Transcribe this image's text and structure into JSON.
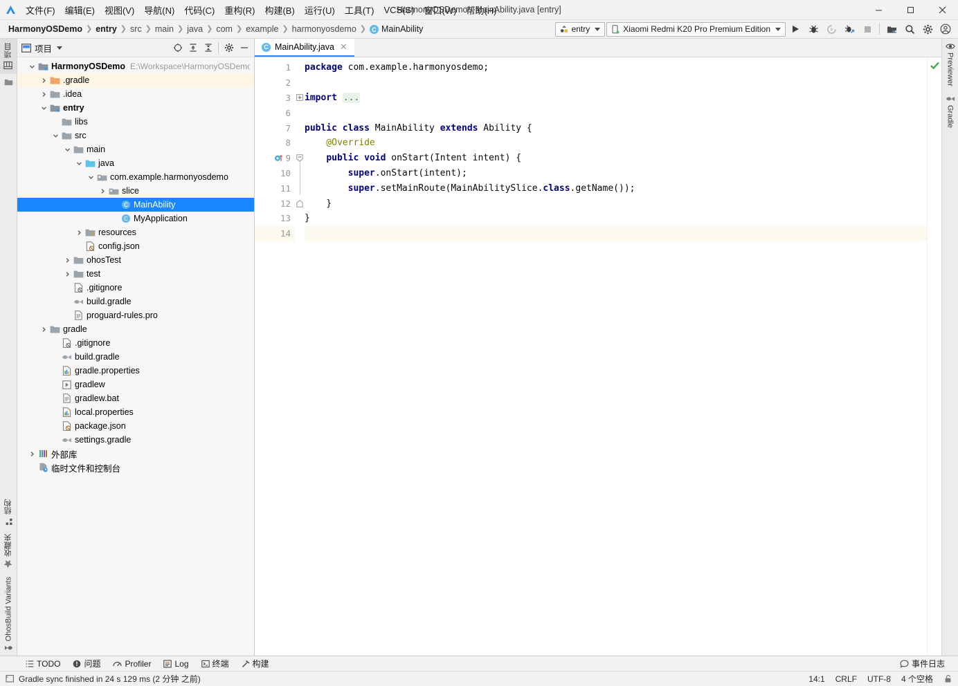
{
  "window": {
    "title": "HarmonyOSDemo - MainAbility.java [entry]",
    "minimize_label": "–",
    "maximize_label": "□",
    "close_label": "✕"
  },
  "menubar": {
    "items": [
      {
        "label": "文件(F)"
      },
      {
        "label": "编辑(E)"
      },
      {
        "label": "视图(V)"
      },
      {
        "label": "导航(N)"
      },
      {
        "label": "代码(C)"
      },
      {
        "label": "重构(R)"
      },
      {
        "label": "构建(B)"
      },
      {
        "label": "运行(U)"
      },
      {
        "label": "工具(T)"
      },
      {
        "label": "VCS(S)"
      },
      {
        "label": "窗口(W)"
      },
      {
        "label": "帮助(H)"
      }
    ]
  },
  "navbar": {
    "breadcrumbs": [
      {
        "label": "HarmonyOSDemo",
        "style": "bold"
      },
      {
        "label": "entry",
        "style": "bold"
      },
      {
        "label": "src",
        "style": "dim"
      },
      {
        "label": "main",
        "style": "dim"
      },
      {
        "label": "java",
        "style": "dim"
      },
      {
        "label": "com",
        "style": "dim"
      },
      {
        "label": "example",
        "style": "dim"
      },
      {
        "label": "harmonyosdemo",
        "style": "dim"
      },
      {
        "label": "MainAbility",
        "style": "normal",
        "icon": "class-icon",
        "badge": "C"
      }
    ],
    "separator": "❯",
    "run_config": {
      "label": "entry",
      "icon": "module-icon"
    },
    "device": {
      "label": "Xiaomi Redmi K20 Pro Premium Edition",
      "icon": "phone-icon"
    },
    "actions": [
      {
        "name": "run-button",
        "glyph": "▶"
      },
      {
        "name": "debug-button",
        "glyph": "bug"
      },
      {
        "name": "run-coverage-button",
        "glyph": "coverage"
      },
      {
        "name": "attach-debugger-button",
        "glyph": "attach"
      },
      {
        "name": "stop-button",
        "glyph": "■"
      },
      {
        "name": "project-structure-button",
        "glyph": "structure"
      },
      {
        "name": "search-everywhere-button",
        "glyph": "search"
      },
      {
        "name": "settings-button",
        "glyph": "gear"
      },
      {
        "name": "account-button",
        "glyph": "account"
      }
    ]
  },
  "left_strip": {
    "top_tabs": [
      {
        "label": "项目",
        "name": "tool-tab-project",
        "active": true
      },
      {
        "label": "",
        "name": "tool-tab-resource-manager",
        "active": false
      }
    ],
    "bottom_tabs": [
      {
        "label": "结构",
        "name": "tool-tab-structure"
      },
      {
        "label": "收藏夹",
        "name": "tool-tab-favorites"
      },
      {
        "label": "OhosBuild Variants",
        "name": "tool-tab-ohosbuild-variants"
      }
    ]
  },
  "right_strip": {
    "tabs": [
      {
        "label": "Previewer",
        "name": "tool-tab-previewer"
      },
      {
        "label": "Gradle",
        "name": "tool-tab-gradle"
      }
    ]
  },
  "project_panel": {
    "title": "项目",
    "header_icons": [
      {
        "name": "select-opened-file-icon",
        "glyph": "target"
      },
      {
        "name": "expand-all-icon",
        "glyph": "expand"
      },
      {
        "name": "collapse-all-icon",
        "glyph": "collapse"
      },
      {
        "name": "panel-settings-icon",
        "glyph": "gear"
      },
      {
        "name": "hide-panel-icon",
        "glyph": "minus"
      }
    ],
    "tree": [
      {
        "label": "HarmonyOSDemo",
        "path": "E:\\Workspace\\HarmonyOSDemo",
        "indent": 0,
        "arrow": "down",
        "icon": "module-folder-icon",
        "bold": true
      },
      {
        "label": ".gradle",
        "indent": 1,
        "arrow": "right",
        "icon": "folder-orange-icon",
        "highlight": true
      },
      {
        "label": ".idea",
        "indent": 1,
        "arrow": "right",
        "icon": "folder-icon"
      },
      {
        "label": "entry",
        "indent": 1,
        "arrow": "down",
        "icon": "module-folder-icon",
        "bold": true
      },
      {
        "label": "libs",
        "indent": 2,
        "arrow": "none",
        "icon": "folder-icon"
      },
      {
        "label": "src",
        "indent": 2,
        "arrow": "down",
        "icon": "folder-icon"
      },
      {
        "label": "main",
        "indent": 3,
        "arrow": "down",
        "icon": "folder-icon"
      },
      {
        "label": "java",
        "indent": 4,
        "arrow": "down",
        "icon": "folder-source-icon"
      },
      {
        "label": "com.example.harmonyosdemo",
        "indent": 5,
        "arrow": "down",
        "icon": "package-icon"
      },
      {
        "label": "slice",
        "indent": 6,
        "arrow": "right",
        "icon": "package-icon"
      },
      {
        "label": "MainAbility",
        "indent": 7,
        "arrow": "none",
        "icon": "java-class-icon",
        "selected": true
      },
      {
        "label": "MyApplication",
        "indent": 7,
        "arrow": "none",
        "icon": "java-class-icon"
      },
      {
        "label": "resources",
        "indent": 4,
        "arrow": "right",
        "icon": "folder-resource-icon"
      },
      {
        "label": "config.json",
        "indent": 4,
        "arrow": "none",
        "icon": "json-file-icon"
      },
      {
        "label": "ohosTest",
        "indent": 3,
        "arrow": "right",
        "icon": "folder-icon"
      },
      {
        "label": "test",
        "indent": 3,
        "arrow": "right",
        "icon": "folder-icon"
      },
      {
        "label": ".gitignore",
        "indent": 3,
        "arrow": "none",
        "icon": "gitignore-file-icon"
      },
      {
        "label": "build.gradle",
        "indent": 3,
        "arrow": "none",
        "icon": "gradle-file-icon"
      },
      {
        "label": "proguard-rules.pro",
        "indent": 3,
        "arrow": "none",
        "icon": "text-file-icon"
      },
      {
        "label": "gradle",
        "indent": 1,
        "arrow": "right",
        "icon": "folder-icon"
      },
      {
        "label": ".gitignore",
        "indent": 2,
        "arrow": "none",
        "icon": "gitignore-file-icon"
      },
      {
        "label": "build.gradle",
        "indent": 2,
        "arrow": "none",
        "icon": "gradle-file-icon"
      },
      {
        "label": "gradle.properties",
        "indent": 2,
        "arrow": "none",
        "icon": "properties-file-icon"
      },
      {
        "label": "gradlew",
        "indent": 2,
        "arrow": "none",
        "icon": "script-file-icon"
      },
      {
        "label": "gradlew.bat",
        "indent": 2,
        "arrow": "none",
        "icon": "text-file-icon"
      },
      {
        "label": "local.properties",
        "indent": 2,
        "arrow": "none",
        "icon": "properties-file-icon"
      },
      {
        "label": "package.json",
        "indent": 2,
        "arrow": "none",
        "icon": "json-file-icon"
      },
      {
        "label": "settings.gradle",
        "indent": 2,
        "arrow": "none",
        "icon": "gradle-file-icon"
      },
      {
        "label": "外部库",
        "indent": 0,
        "arrow": "right",
        "icon": "external-libraries-icon"
      },
      {
        "label": "临时文件和控制台",
        "indent": 0,
        "arrow": "none",
        "icon": "scratches-icon"
      }
    ]
  },
  "editor": {
    "tabs": [
      {
        "label": "MainAbility.java",
        "badge": "C",
        "close": "✕",
        "active": true
      }
    ],
    "inspection_status": "ok-check",
    "lines": [
      {
        "num": "1",
        "tokens": [
          {
            "t": "package",
            "c": "kw"
          },
          {
            "t": " com.example.harmonyosdemo;",
            "c": "plain"
          }
        ]
      },
      {
        "num": "2",
        "tokens": []
      },
      {
        "num": "3",
        "fold": "plus",
        "tokens": [
          {
            "t": "import",
            "c": "kw"
          },
          {
            "t": " ",
            "c": "plain"
          },
          {
            "t": "...",
            "c": "fold"
          }
        ]
      },
      {
        "num": "6",
        "tokens": []
      },
      {
        "num": "7",
        "tokens": [
          {
            "t": "public",
            "c": "kw"
          },
          {
            "t": " ",
            "c": "plain"
          },
          {
            "t": "class",
            "c": "kw"
          },
          {
            "t": " MainAbility ",
            "c": "plain"
          },
          {
            "t": "extends",
            "c": "kw"
          },
          {
            "t": " Ability {",
            "c": "plain"
          }
        ]
      },
      {
        "num": "8",
        "tokens": [
          {
            "t": "    @Override",
            "c": "ann"
          }
        ]
      },
      {
        "num": "9",
        "marker": "override-method-icon",
        "fold": "minus",
        "tokens": [
          {
            "t": "    ",
            "c": "plain"
          },
          {
            "t": "public",
            "c": "kw"
          },
          {
            "t": " ",
            "c": "plain"
          },
          {
            "t": "void",
            "c": "kw"
          },
          {
            "t": " onStart(Intent intent) {",
            "c": "plain"
          }
        ]
      },
      {
        "num": "10",
        "tokens": [
          {
            "t": "        ",
            "c": "plain"
          },
          {
            "t": "super",
            "c": "kw"
          },
          {
            "t": ".onStart(intent);",
            "c": "plain"
          }
        ]
      },
      {
        "num": "11",
        "tokens": [
          {
            "t": "        ",
            "c": "plain"
          },
          {
            "t": "super",
            "c": "kw"
          },
          {
            "t": ".setMainRoute(MainAbilitySlice.",
            "c": "plain"
          },
          {
            "t": "class",
            "c": "kw"
          },
          {
            "t": ".getName());",
            "c": "plain"
          }
        ]
      },
      {
        "num": "12",
        "fold": "end",
        "tokens": [
          {
            "t": "    }",
            "c": "plain"
          }
        ]
      },
      {
        "num": "13",
        "tokens": [
          {
            "t": "}",
            "c": "plain"
          }
        ]
      },
      {
        "num": "14",
        "current": true,
        "tokens": []
      }
    ]
  },
  "bottom_bar": {
    "tabs": [
      {
        "label": "TODO",
        "name": "bottom-tab-todo",
        "icon": "todo-icon"
      },
      {
        "label": "问题",
        "name": "bottom-tab-problems",
        "icon": "problems-icon"
      },
      {
        "label": "Profiler",
        "name": "bottom-tab-profiler",
        "icon": "profiler-icon"
      },
      {
        "label": "Log",
        "name": "bottom-tab-log",
        "icon": "log-icon"
      },
      {
        "label": "终端",
        "name": "bottom-tab-terminal",
        "icon": "terminal-icon"
      },
      {
        "label": "构建",
        "name": "bottom-tab-build",
        "icon": "build-icon"
      }
    ],
    "event_log": {
      "label": "事件日志",
      "icon": "event-log-icon"
    }
  },
  "statusbar": {
    "message": "Gradle sync finished in 24 s 129 ms (2 分钟 之前)",
    "message_icon": "status-message-icon",
    "caret_position": "14:1",
    "line_separator": "CRLF",
    "encoding": "UTF-8",
    "indent": "4 个空格",
    "lock_icon": "write-lock-icon"
  },
  "colors": {
    "accent": "#1a86ff",
    "keyword": "#000080",
    "annotation": "#808000",
    "tab_underline": "#3a82f7",
    "highlight_row": "#fdf6e3",
    "folder_orange": "#f4a261"
  }
}
